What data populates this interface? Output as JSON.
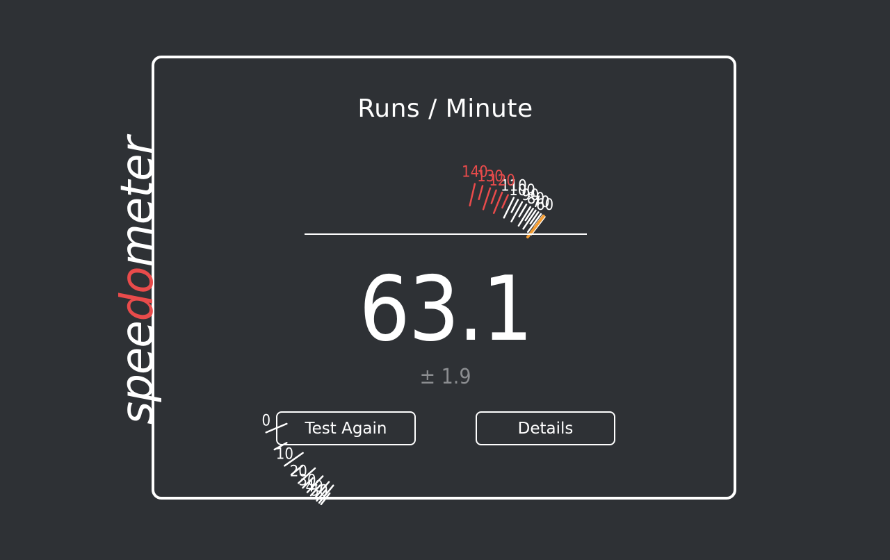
{
  "app": {
    "logo_parts": [
      "spee",
      "do",
      "meter"
    ],
    "title": "Runs / Minute"
  },
  "result": {
    "score": "63.1",
    "uncertainty": "± 1.9",
    "needle_value": 63.1
  },
  "gauge": {
    "min": 0,
    "max": 140,
    "redline_start": 115,
    "labels": [
      "0",
      "10",
      "20",
      "30",
      "40",
      "50",
      "60",
      "70",
      "80",
      "90",
      "100",
      "110",
      "120",
      "130",
      "140"
    ],
    "label_values": [
      0,
      10,
      20,
      30,
      40,
      50,
      60,
      70,
      80,
      90,
      100,
      110,
      120,
      130,
      140
    ]
  },
  "buttons": {
    "test_again": "Test Again",
    "details": "Details"
  },
  "colors": {
    "background": "#2e3135",
    "foreground": "#ffffff",
    "accent_red": "#e94b4b",
    "needle": "#f39c32",
    "muted": "#8b8d90"
  }
}
